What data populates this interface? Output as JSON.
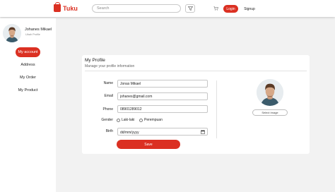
{
  "header": {
    "brand": "Tuku",
    "search_placeholder": "Search",
    "login_label": "Login",
    "signup_label": "Signup",
    "icons": [
      "shopping-bag-icon",
      "filter-icon",
      "cart-icon"
    ]
  },
  "sidebar": {
    "user_name": "Johanes Mikael",
    "user_subtitle": "Ubah Profile",
    "items": [
      {
        "label": "My account"
      },
      {
        "label": "Address"
      },
      {
        "label": "My Order"
      },
      {
        "label": "My Product"
      }
    ]
  },
  "profile": {
    "title": "My Profile",
    "subtitle": "Manage your profile information",
    "name_label": "Name",
    "name_value": "Jonas Mikael",
    "email_label": "Email",
    "email_value": "johanes@gmail.com",
    "phone_label": "Phone",
    "phone_value": "08901289012",
    "gender_label": "Gender",
    "gender_options": [
      "Laki-laki",
      "Perempuan"
    ],
    "birth_label": "Birth",
    "birth_placeholder": "dd/mm/yyyy",
    "save_label": "Save",
    "select_image_label": "Select Image"
  },
  "colors": {
    "accent": "#db3022",
    "background": "#f2f2f2"
  }
}
